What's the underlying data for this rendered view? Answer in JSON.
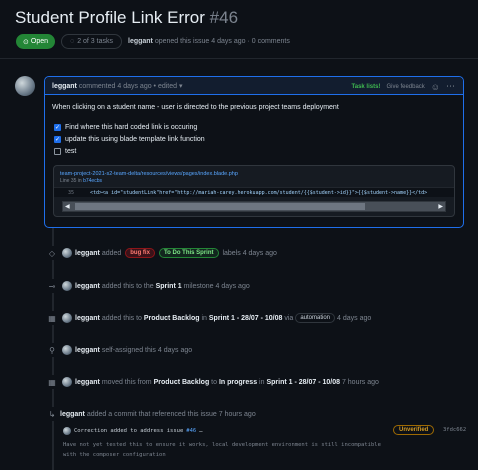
{
  "issue": {
    "title": "Student Profile Link Error",
    "number": "#46",
    "state": "Open",
    "tasks": "2 of 3 tasks",
    "author": "leggant",
    "subline": "opened this issue 4 days ago · 0 comments"
  },
  "comment": {
    "author": "leggant",
    "meta": "commented 4 days ago • edited",
    "task_lists_label": "Task lists!",
    "give_feedback": "Give feedback",
    "body": "When clicking on a student name - user is directed to the previous project teams deployment",
    "tasks": [
      {
        "label": "Find where this hard coded link is occuring",
        "checked": true
      },
      {
        "label": "update this using blade template link function",
        "checked": true
      },
      {
        "label": "test",
        "checked": false
      }
    ],
    "code": {
      "file": "team-project-2021-s2-team-delta/resources/views/pages/index.blade.php",
      "lines_text": "Line 35 in",
      "commit": "b74ecbs",
      "line_no": "35",
      "source": "<td><a id=\"studentLink\"href=\"http://mariah-carey.herokuapp.com/student/{{$student->id}}\">{{$student->name}}</td>"
    }
  },
  "timeline": [
    {
      "icon": "tag-icon",
      "user": "leggant",
      "pre": "added",
      "labels": [
        "bug fix",
        "To Do This Sprint"
      ],
      "post": "labels 4 days ago"
    },
    {
      "icon": "milestone-icon",
      "user": "leggant",
      "pre": "added this to the",
      "bold1": "Sprint 1",
      "post": "milestone 4 days ago"
    },
    {
      "icon": "project-icon",
      "user": "leggant",
      "pre": "added this to",
      "bold1": "Product Backlog",
      "mid": "in",
      "bold2": "Sprint 1 - 28/07 - 10/08",
      "via": "via",
      "pill": "automation",
      "post": "4 days ago"
    },
    {
      "icon": "person-icon",
      "user": "leggant",
      "pre": "self-assigned this 4 days ago"
    },
    {
      "icon": "project-icon",
      "user": "leggant",
      "pre": "moved this from",
      "bold1": "Product Backlog",
      "mid": "to",
      "bold2": "In progress",
      "mid2": "in",
      "bold3": "Sprint 1 - 28/07 - 10/08",
      "post": "7 hours ago"
    },
    {
      "icon": "cross-reference-icon",
      "user": "leggant",
      "pre": "added a commit that referenced this issue 7 hours ago"
    }
  ],
  "commit": {
    "message": "Correction added to address issue",
    "issue_ref": "#46",
    "badge": "Unverified",
    "sha": "3fdc662",
    "description": "Have not yet tested this to ensure it works, local development environment is still incompatible with the composer configuration"
  }
}
